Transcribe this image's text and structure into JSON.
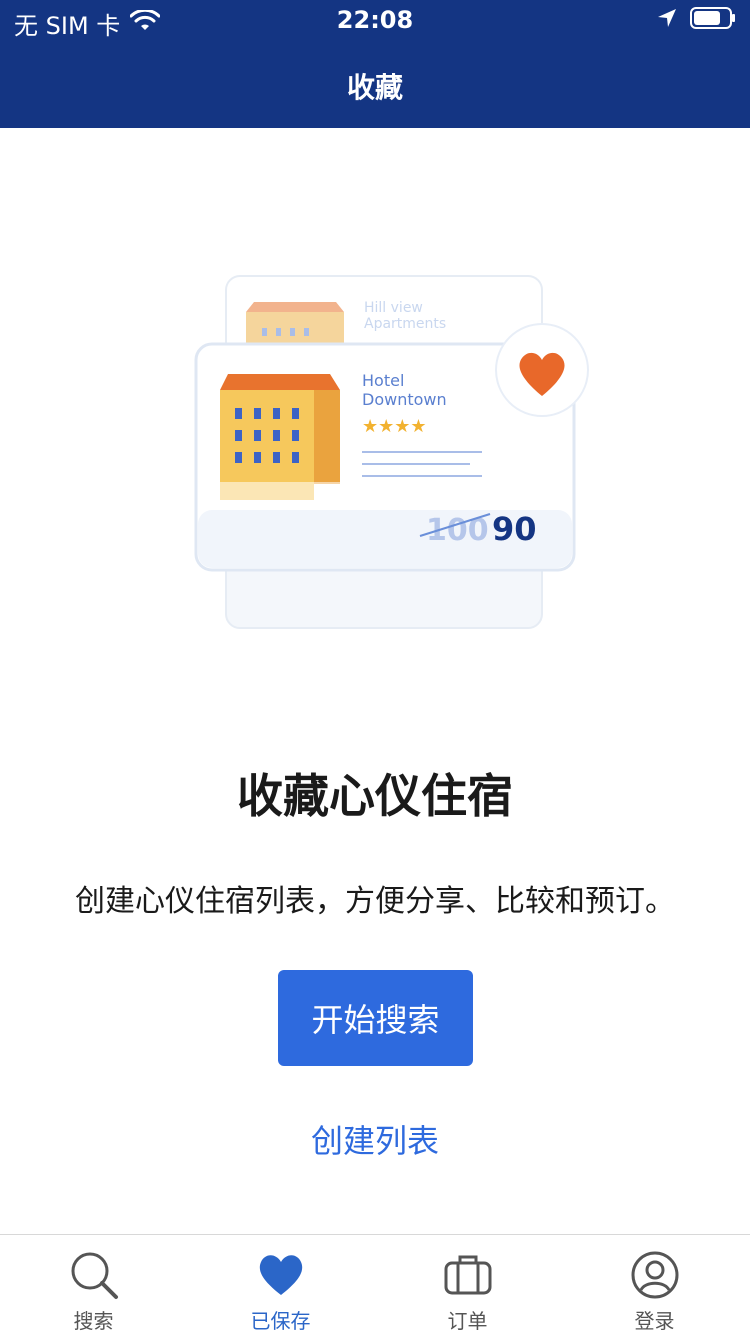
{
  "status_bar": {
    "carrier": "无 SIM 卡",
    "time": "22:08"
  },
  "nav": {
    "title": "收藏"
  },
  "illustration": {
    "back_card_title_line1": "Hill view",
    "back_card_title_line2": "Apartments",
    "front_card_title_line1": "Hotel",
    "front_card_title_line2": "Downtown",
    "old_price": "100",
    "new_price": "90"
  },
  "empty_state": {
    "headline": "收藏心仪住宿",
    "subtitle": "创建心仪住宿列表，方便分享、比较和预订。",
    "primary_button": "开始搜索",
    "secondary_link": "创建列表"
  },
  "tabbar": {
    "items": [
      {
        "label": "搜索",
        "icon": "search-icon"
      },
      {
        "label": "已保存",
        "icon": "heart-icon",
        "active": true
      },
      {
        "label": "订单",
        "icon": "suitcase-icon"
      },
      {
        "label": "登录",
        "icon": "account-icon"
      }
    ]
  },
  "colors": {
    "brand_dark": "#143583",
    "accent_blue": "#2e6ade",
    "heart_orange": "#e8682a"
  }
}
